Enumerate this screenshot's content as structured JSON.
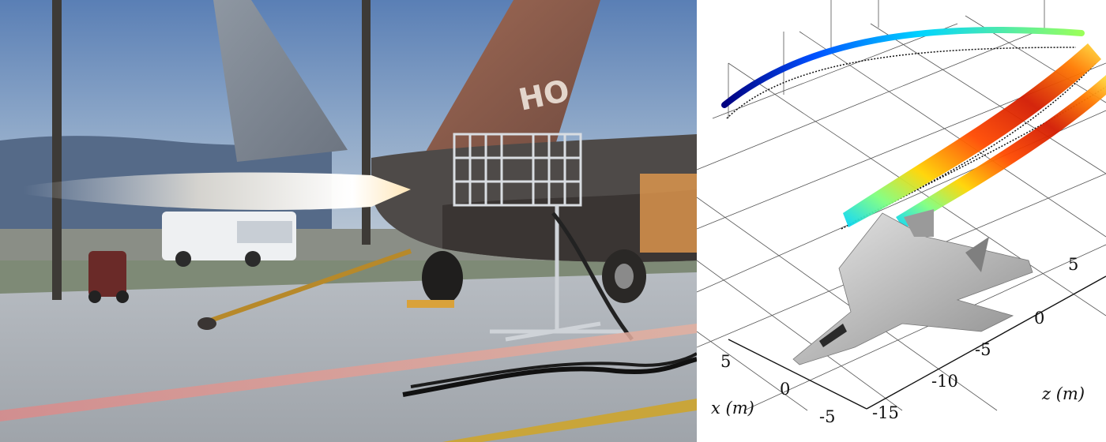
{
  "photo": {
    "tail_marking": "HO"
  },
  "plot": {
    "x_axis_label": "x (m)",
    "z_axis_label": "z (m)",
    "x_ticks": [
      "5",
      "0",
      "-5"
    ],
    "z_ticks": [
      "5",
      "0",
      "-5",
      "-10",
      "-15"
    ],
    "colormap": [
      "#00007f",
      "#0050ff",
      "#00d4ff",
      "#7fff7f",
      "#ffd400",
      "#ff4a00",
      "#b00000"
    ]
  }
}
